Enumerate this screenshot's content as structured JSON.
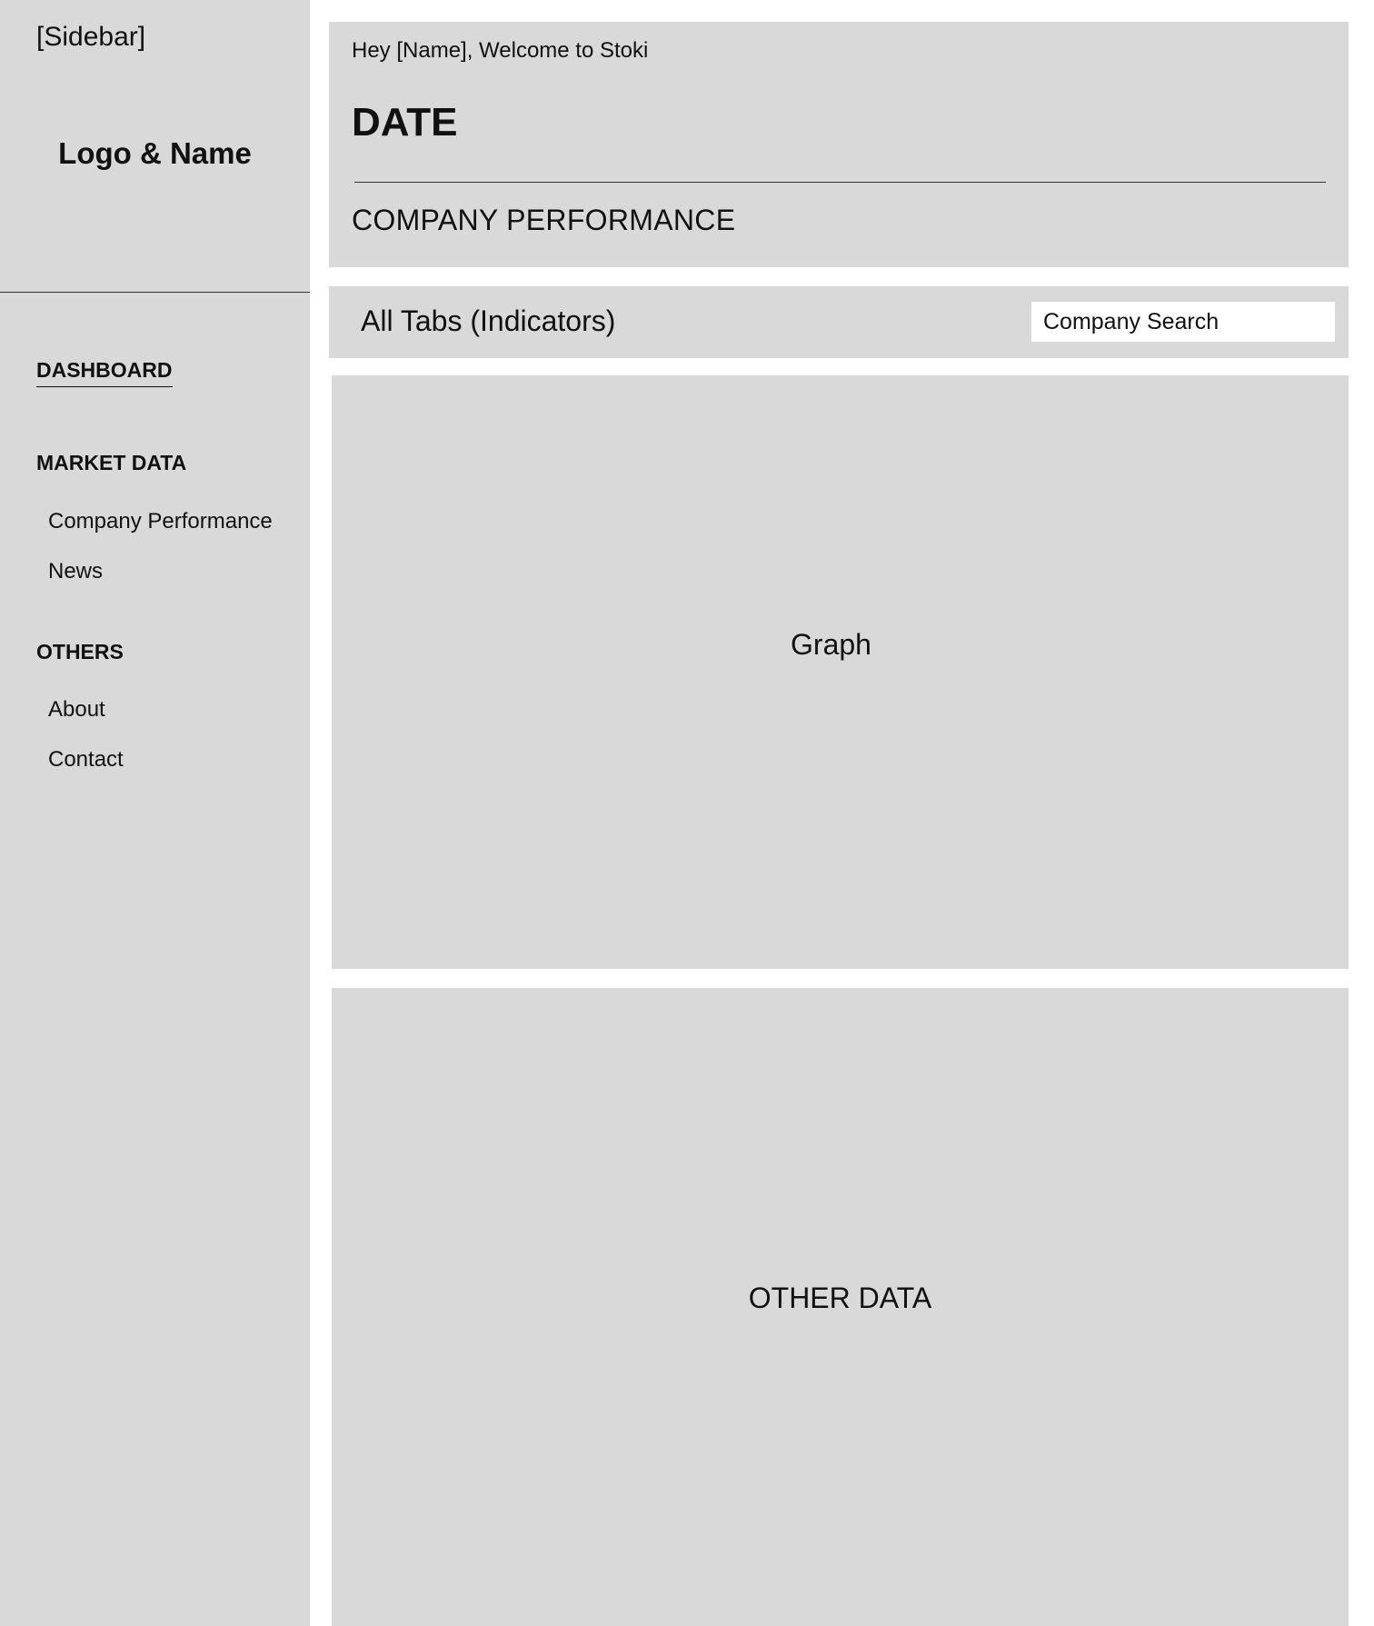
{
  "sidebar": {
    "placeholder": "[Sidebar]",
    "logo": "Logo & Name",
    "nav": {
      "dashboard": "DASHBOARD",
      "sections": [
        {
          "title": "MARKET DATA",
          "items": [
            "Company Performance",
            "News"
          ]
        },
        {
          "title": "OTHERS",
          "items": [
            "About",
            "Contact"
          ]
        }
      ]
    }
  },
  "header": {
    "greeting": "Hey [Name], Welcome to Stoki",
    "date": "DATE",
    "subtitle": "COMPANY PERFORMANCE"
  },
  "toolbar": {
    "tabs_label": "All Tabs (Indicators)",
    "search_placeholder": "Company Search"
  },
  "main": {
    "graph_label": "Graph",
    "other_label": "OTHER DATA"
  },
  "colors": {
    "panel_bg": "#d9d9d9",
    "page_bg": "#ffffff",
    "text": "#111111"
  }
}
